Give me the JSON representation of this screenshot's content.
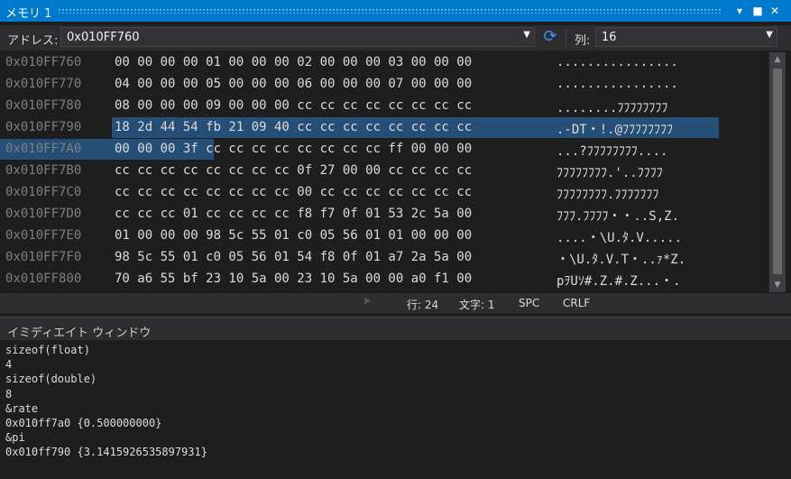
{
  "memory_window": {
    "title": "メモリ 1",
    "pin_icon": "dropdown-arrow-icon",
    "maximize_icon": "maximize-icon",
    "close_icon": "close-icon",
    "address_label": "アドレス:",
    "address_value": "0x010FF760",
    "column_label": "列:",
    "column_value": "16",
    "rows": [
      {
        "addr": "0x010FF760",
        "hex": "00 00 00 00 01 00 00 00 02 00 00 00 03 00 00 00",
        "ascii": "................"
      },
      {
        "addr": "0x010FF770",
        "hex": "04 00 00 00 05 00 00 00 06 00 00 00 07 00 00 00",
        "ascii": "................"
      },
      {
        "addr": "0x010FF780",
        "hex": "08 00 00 00 09 00 00 00 cc cc cc cc cc cc cc cc",
        "ascii": "........ﾌﾌﾌﾌﾌﾌﾌﾌ"
      },
      {
        "addr": "0x010FF790",
        "hex": "18 2d 44 54 fb 21 09 40 cc cc cc cc cc cc cc cc",
        "ascii": ".-DT・!.@ﾌﾌﾌﾌﾌﾌﾌﾌ"
      },
      {
        "addr": "0x010FF7A0",
        "hex": "00 00 00 3f cc cc cc cc cc cc cc cc ff 00 00 00",
        "ascii": "...?ﾌﾌﾌﾌﾌﾌﾌﾌ...."
      },
      {
        "addr": "0x010FF7B0",
        "hex": "cc cc cc cc cc cc cc cc 0f 27 00 00 cc cc cc cc",
        "ascii": "ﾌﾌﾌﾌﾌﾌﾌﾌ.'..ﾌﾌﾌﾌ"
      },
      {
        "addr": "0x010FF7C0",
        "hex": "cc cc cc cc cc cc cc cc 00 cc cc cc cc cc cc cc",
        "ascii": "ﾌﾌﾌﾌﾌﾌﾌﾌ.ﾌﾌﾌﾌﾌﾌﾌ"
      },
      {
        "addr": "0x010FF7D0",
        "hex": "cc cc cc 01 cc cc cc cc f8 f7 0f 01 53 2c 5a 00",
        "ascii": "ﾌﾌﾌ.ﾌﾌﾌﾌ・・..S,Z."
      },
      {
        "addr": "0x010FF7E0",
        "hex": "01 00 00 00 98 5c 55 01 c0 05 56 01 01 00 00 00",
        "ascii": "....・\\U.ﾀ.V....."
      },
      {
        "addr": "0x010FF7F0",
        "hex": "98 5c 55 01 c0 05 56 01 54 f8 0f 01 a7 2a 5a 00",
        "ascii": "・\\U.ﾀ.V.T・..ｧ*Z."
      },
      {
        "addr": "0x010FF800",
        "hex": "70 a6 55 bf 23 10 5a 00 23 10 5a 00 00 a0 f1 00",
        "ascii": "pｦUｿ#.Z.#.Z...・."
      }
    ]
  },
  "status_bar": {
    "line": "行: 24",
    "char": "文字: 1",
    "mode": "SPC",
    "eol": "CRLF"
  },
  "immediate_window": {
    "title": "イミディエイト ウィンドウ",
    "lines": [
      "sizeof(float)",
      "4",
      "sizeof(double)",
      "8",
      "&rate",
      "0x010ff7a0 {0.500000000}",
      "&pi",
      "0x010ff790 {3.1415926535897931}"
    ]
  }
}
